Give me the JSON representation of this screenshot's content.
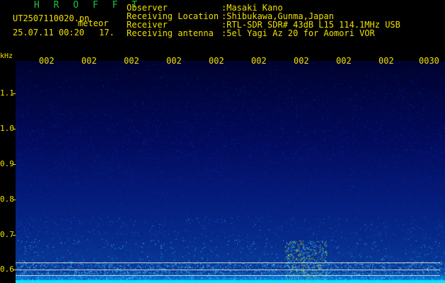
{
  "header": {
    "title": "H R O F F T",
    "filename": "UT2507110020.pn",
    "meteor_label": "meteor",
    "datetime": "25.07.11 00:20",
    "count": "17."
  },
  "info": {
    "labels": [
      "Observer",
      "Receiving Location",
      "Receiver",
      "Receiving antenna"
    ],
    "values": [
      ":Masaki Kano",
      ":Shibukawa,Gunma,Japan",
      ":RTL-SDR SDR# 43dB L15 114.1MHz USB",
      ":5el Yagi Az 20 for Aomori VOR"
    ]
  },
  "axes": {
    "unit": "kHz",
    "x_ticks": [
      "002",
      "002",
      "002",
      "002",
      "002",
      "002",
      "002",
      "002",
      "002",
      "0030"
    ],
    "y_ticks": [
      "1.1",
      "1.0",
      "0.9",
      "0.8",
      "0.7",
      "0.6"
    ]
  },
  "colors": {
    "label_text": "#f0e000",
    "title_text": "#20c040",
    "background": "#000000"
  }
}
